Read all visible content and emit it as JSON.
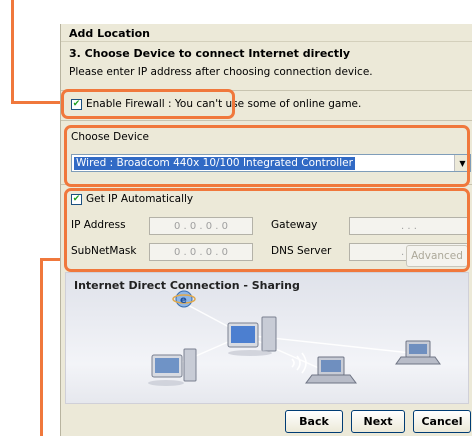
{
  "dialog": {
    "title": "Add Location",
    "step_title": "3. Choose Device to connect Internet directly",
    "step_desc": "Please enter IP address after choosing connection device."
  },
  "firewall": {
    "checked": true,
    "label": "Enable Firewall : You can't use some of online game."
  },
  "device": {
    "label": "Choose Device",
    "selected": "Wired : Broadcom 440x 10/100 Integrated Controller"
  },
  "ip": {
    "auto_checked": true,
    "auto_label": "Get IP Automatically",
    "ip_address_label": "IP Address",
    "ip_address_value": "0 . 0 . 0 . 0",
    "subnet_label": "SubNetMask",
    "subnet_value": "0 . 0 . 0 . 0",
    "gateway_label": "Gateway",
    "gateway_value": ". . .",
    "dns_label": "DNS Server",
    "dns_value": ". . ."
  },
  "advanced_button": "Advanced",
  "sharing": {
    "title": "Internet Direct Connection - Sharing"
  },
  "footer": {
    "back": "Back",
    "next": "Next",
    "cancel": "Cancel"
  },
  "colors": {
    "callout": "#f0783c",
    "selection": "#316ac5"
  },
  "icons": [
    "ie-globe-icon",
    "desktop-pc-icon",
    "server-icon",
    "laptop-icon",
    "wireless-signal-icon"
  ]
}
